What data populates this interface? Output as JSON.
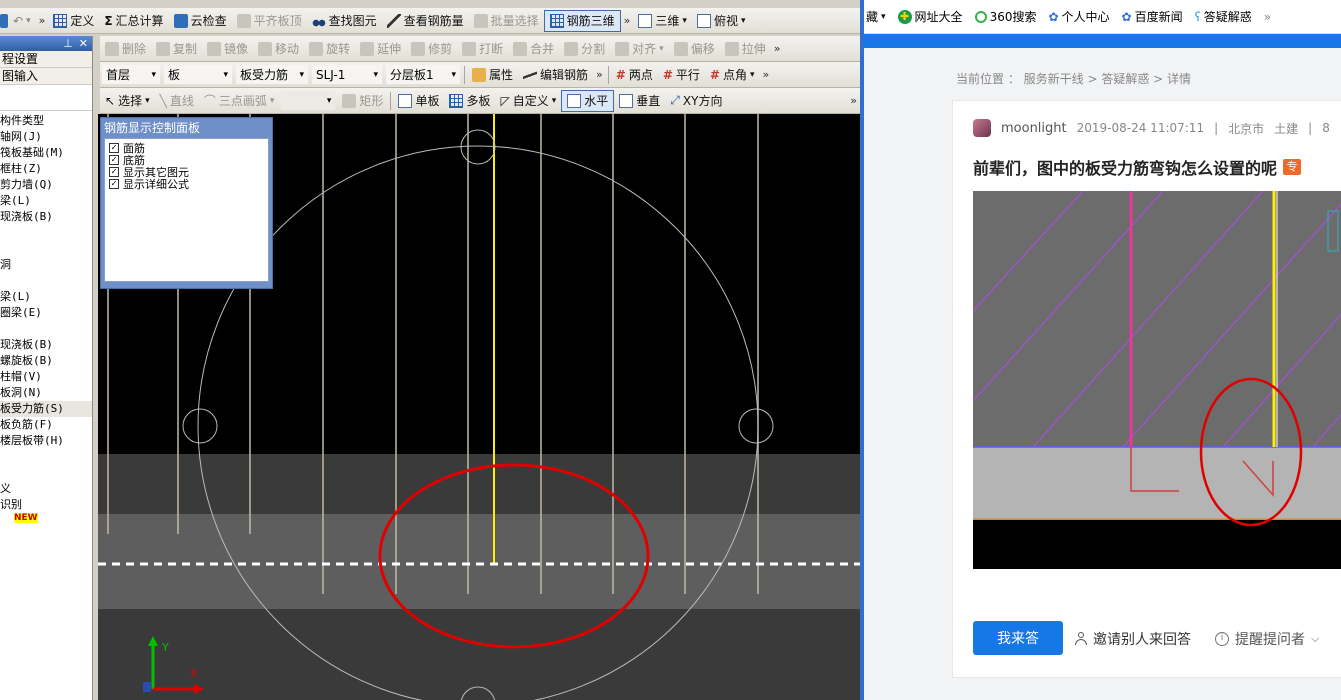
{
  "toolbar1": {
    "undo_arrow": "↶",
    "define": "定义",
    "sum": "汇总计算",
    "sigma": "Σ",
    "cloud": "云检查",
    "level_slab": "平齐板顶",
    "find_elem": "查找图元",
    "view_rebar": "查看钢筋量",
    "batch_select": "批量选择",
    "rebar_3d": "钢筋三维",
    "three_d": "三维",
    "top_view": "俯视"
  },
  "toolbar2": {
    "delete": "删除",
    "copy": "复制",
    "mirror": "镜像",
    "move": "移动",
    "rotate": "旋转",
    "extend": "延伸",
    "trim": "修剪",
    "break": "打断",
    "merge": "合并",
    "split": "分割",
    "align": "对齐",
    "offset": "偏移",
    "stretch": "拉伸"
  },
  "toolbar3": {
    "floor": "首层",
    "category": "板",
    "type": "板受力筋",
    "name": "SLJ-1",
    "layer": "分层板1",
    "property": "属性",
    "edit_rebar": "编辑钢筋",
    "two_points": "两点",
    "parallel": "平行",
    "point_angle": "点角"
  },
  "toolbar4": {
    "select": "选择",
    "line": "直线",
    "arc3": "三点画弧",
    "rect": "矩形",
    "single_slab": "单板",
    "multi_slab": "多板",
    "custom": "自定义",
    "horizontal": "水平",
    "vertical": "垂直",
    "xy_dir": "XY方向"
  },
  "left_panel": {
    "item1": "程设置",
    "item2": "图输入",
    "tree": [
      "构件类型",
      "轴网(J)",
      "筏板基础(M)",
      "框柱(Z)",
      "剪力墙(Q)",
      "梁(L)",
      "现浇板(B)",
      "",
      "",
      "洞",
      "",
      "梁(L)",
      "圈梁(E)",
      "",
      "现浇板(B)",
      "螺旋板(B)",
      "柱帽(V)",
      "板洞(N)",
      "板受力筋(S)",
      "板负筋(F)",
      "楼层板带(H)",
      "",
      "",
      "义",
      "识别"
    ],
    "new_badge": "NEW"
  },
  "control_panel": {
    "title": "钢筋显示控制面板",
    "options": [
      "面筋",
      "底筋",
      "显示其它图元",
      "显示详细公式"
    ]
  },
  "axis": {
    "y": "Y",
    "x": "X"
  },
  "browser": {
    "bookmarks": [
      "网址大全",
      "360搜索",
      "个人中心",
      "百度新闻",
      "答疑解惑"
    ],
    "bm_cut": "藏",
    "breadcrumb": "当前位置 ： 服务新干线 > 答疑解惑 > 详情",
    "user": "moonlight",
    "time": "2019-08-24 11:07:11",
    "location": "北京市",
    "specialty": "土建",
    "sep": "|",
    "sep_extra": "8",
    "question": "前辈们，图中的板受力筋弯钩怎么设置的呢",
    "badge": "专",
    "answer_btn": "我来答",
    "invite": "邀请别人来回答",
    "remind": "提醒提问者"
  },
  "colors": {
    "accent": "#1677e6",
    "annotation": "#e00000",
    "rebar_yellow": "#ffee00",
    "rebar_pink": "#ff2fa0"
  }
}
